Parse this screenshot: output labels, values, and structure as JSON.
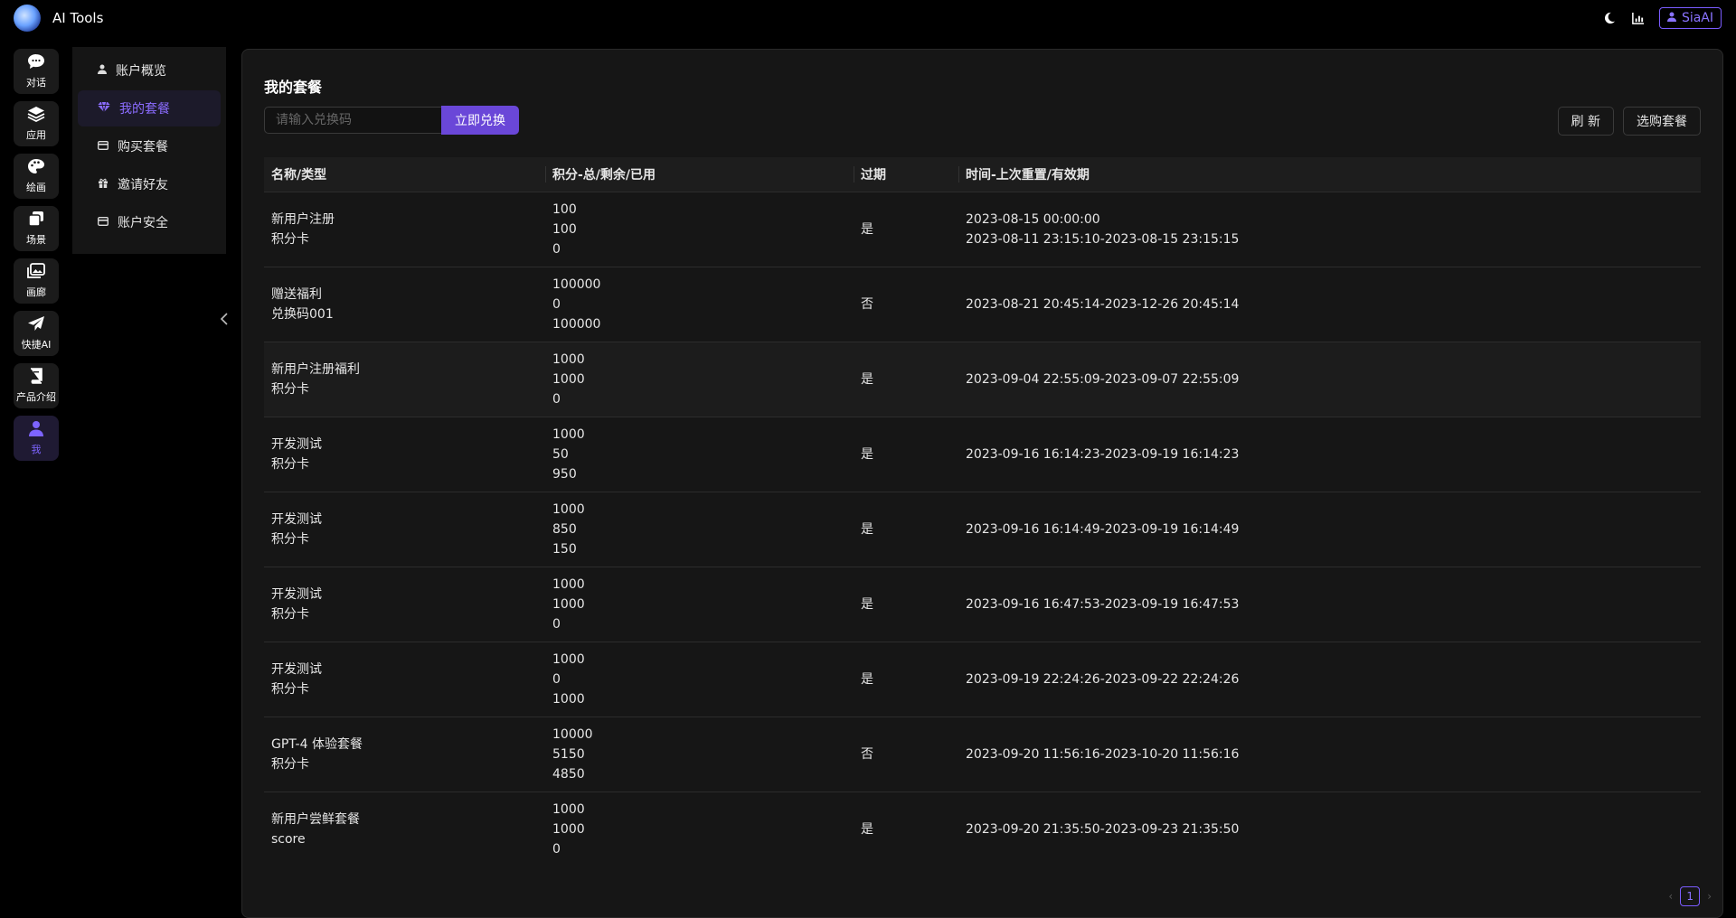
{
  "app": {
    "title": "AI Tools",
    "user": "SiaAI"
  },
  "rail": [
    {
      "label": "对话",
      "icon": "chat-icon"
    },
    {
      "label": "应用",
      "icon": "layers-icon"
    },
    {
      "label": "绘画",
      "icon": "palette-icon"
    },
    {
      "label": "场景",
      "icon": "cards-icon"
    },
    {
      "label": "画廊",
      "icon": "gallery-icon"
    },
    {
      "label": "快捷AI",
      "icon": "send-icon"
    },
    {
      "label": "产品介绍",
      "icon": "book-icon"
    },
    {
      "label": "我",
      "icon": "user-icon"
    }
  ],
  "submenu": [
    {
      "label": "账户概览",
      "icon": "user-icon"
    },
    {
      "label": "我的套餐",
      "icon": "diamond-icon"
    },
    {
      "label": "购买套餐",
      "icon": "card-icon"
    },
    {
      "label": "邀请好友",
      "icon": "gift-icon"
    },
    {
      "label": "账户安全",
      "icon": "card-icon"
    }
  ],
  "main": {
    "title": "我的套餐",
    "redeem_placeholder": "请输入兑换码",
    "redeem_button": "立即兑换",
    "refresh_button": "刷 新",
    "select_button": "选购套餐",
    "columns": [
      "名称/类型",
      "积分-总/剩余/已用",
      "过期",
      "时间-上次重置/有效期"
    ],
    "rows": [
      {
        "name": "新用户注册",
        "type": "积分卡",
        "total": "100",
        "remain": "100",
        "used": "0",
        "expired": "是",
        "reset": "2023-08-15 00:00:00",
        "period": "2023-08-11 23:15:10-2023-08-15 23:15:15"
      },
      {
        "name": "赠送福利",
        "type": "兑换码001",
        "total": "100000",
        "remain": "0",
        "used": "100000",
        "expired": "否",
        "reset": "",
        "period": "2023-08-21 20:45:14-2023-12-26 20:45:14"
      },
      {
        "name": "新用户注册福利",
        "type": "积分卡",
        "total": "1000",
        "remain": "1000",
        "used": "0",
        "expired": "是",
        "reset": "",
        "period": "2023-09-04 22:55:09-2023-09-07 22:55:09"
      },
      {
        "name": "开发测试",
        "type": "积分卡",
        "total": "1000",
        "remain": "50",
        "used": "950",
        "expired": "是",
        "reset": "",
        "period": "2023-09-16 16:14:23-2023-09-19 16:14:23"
      },
      {
        "name": "开发测试",
        "type": "积分卡",
        "total": "1000",
        "remain": "850",
        "used": "150",
        "expired": "是",
        "reset": "",
        "period": "2023-09-16 16:14:49-2023-09-19 16:14:49"
      },
      {
        "name": "开发测试",
        "type": "积分卡",
        "total": "1000",
        "remain": "1000",
        "used": "0",
        "expired": "是",
        "reset": "",
        "period": "2023-09-16 16:47:53-2023-09-19 16:47:53"
      },
      {
        "name": "开发测试",
        "type": "积分卡",
        "total": "1000",
        "remain": "0",
        "used": "1000",
        "expired": "是",
        "reset": "",
        "period": "2023-09-19 22:24:26-2023-09-22 22:24:26"
      },
      {
        "name": "GPT-4 体验套餐",
        "type": "积分卡",
        "total": "10000",
        "remain": "5150",
        "used": "4850",
        "expired": "否",
        "reset": "",
        "period": "2023-09-20 11:56:16-2023-10-20 11:56:16"
      },
      {
        "name": "新用户尝鲜套餐",
        "type": "score",
        "total": "1000",
        "remain": "1000",
        "used": "0",
        "expired": "是",
        "reset": "",
        "period": "2023-09-20 21:35:50-2023-09-23 21:35:50"
      }
    ],
    "page": "1"
  },
  "colors": {
    "accent": "#7b5cff",
    "bg": "#000000",
    "panel": "#161616"
  }
}
